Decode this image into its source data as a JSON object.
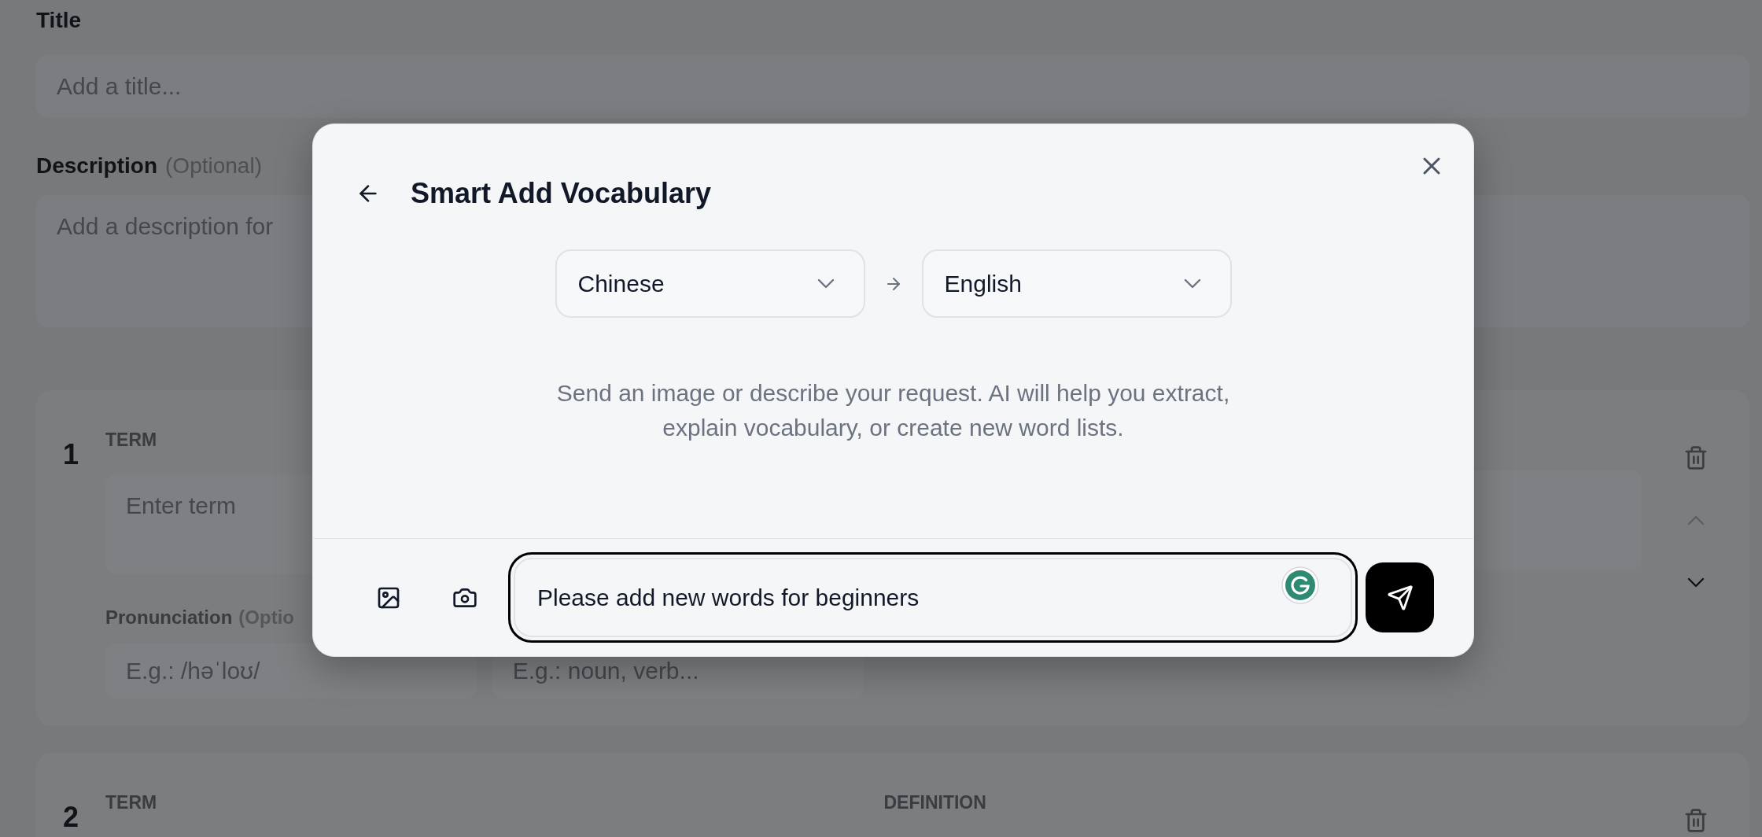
{
  "form": {
    "title_field": {
      "label": "Title",
      "placeholder": "Add a title..."
    },
    "description_field": {
      "label": "Description",
      "hint": "(Optional)",
      "placeholder": "Add a description for"
    },
    "cards": [
      {
        "number": "1",
        "term": {
          "label": "TERM",
          "placeholder": "Enter term"
        },
        "pronunciation": {
          "label": "Pronunciation",
          "hint": "(Optio",
          "placeholder": "E.g.: /həˈloʊ/"
        },
        "part_of_speech": {
          "placeholder": "E.g.: noun, verb..."
        },
        "move_up": {
          "disabled": true
        },
        "move_down": {
          "disabled": false
        }
      },
      {
        "number": "2",
        "term": {
          "label": "TERM"
        },
        "definition": {
          "label": "DEFINITION"
        }
      }
    ]
  },
  "dialog": {
    "title": "Smart Add Vocabulary",
    "source_language": "Chinese",
    "target_language": "English",
    "intro": "Send an image or describe your request. AI will help you extract, explain vocabulary, or create new word lists.",
    "prompt": {
      "value": "Please add new words for beginners"
    }
  }
}
